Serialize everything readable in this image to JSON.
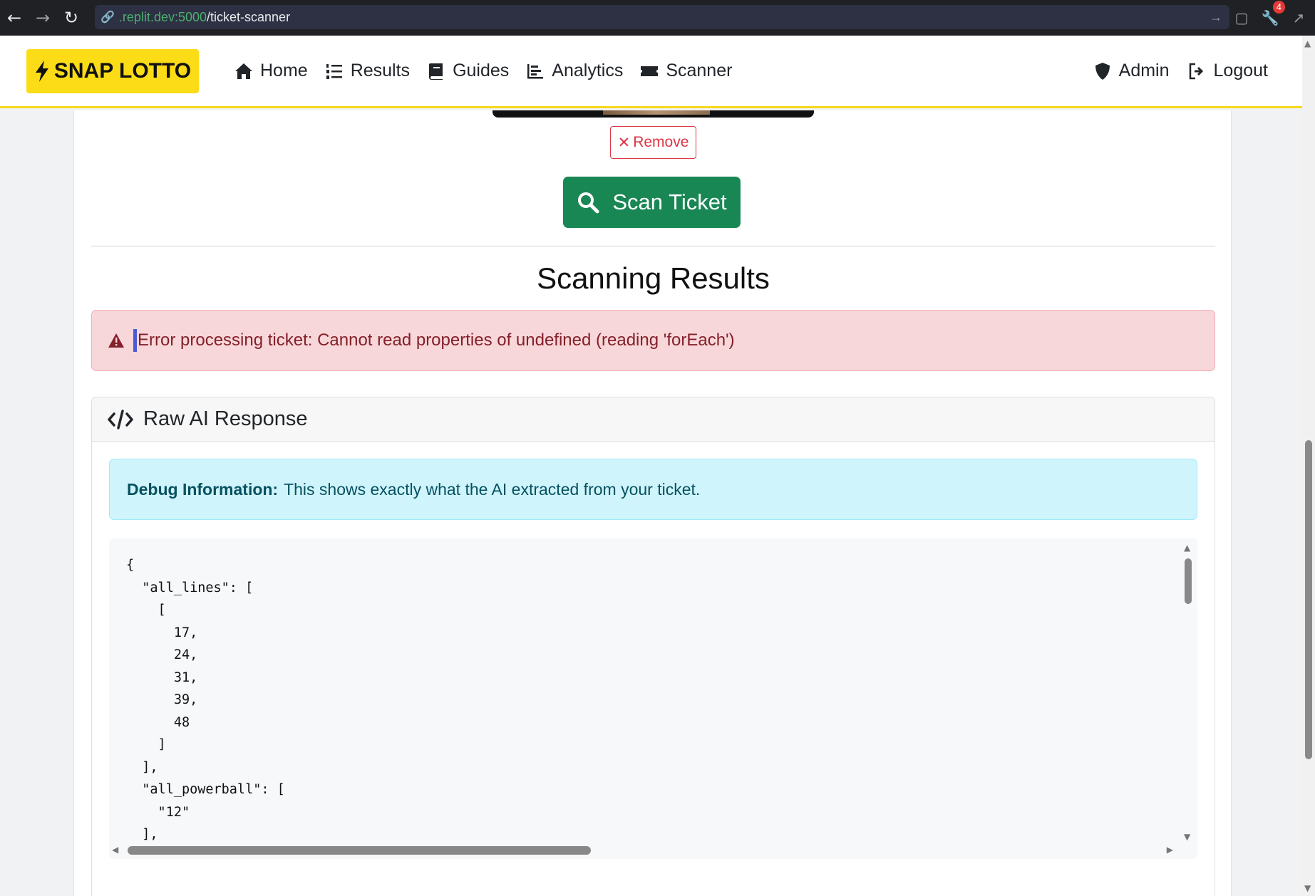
{
  "browser": {
    "url_host": ".replit.dev:5000",
    "url_path": "/ticket-scanner",
    "badge_count": "4"
  },
  "navbar": {
    "brand": "SNAP LOTTO",
    "links": [
      {
        "label": "Home",
        "icon": "home-icon"
      },
      {
        "label": "Results",
        "icon": "list-ordered-icon"
      },
      {
        "label": "Guides",
        "icon": "book-icon"
      },
      {
        "label": "Analytics",
        "icon": "chart-bar-icon"
      },
      {
        "label": "Scanner",
        "icon": "ticket-icon"
      }
    ],
    "right": [
      {
        "label": "Admin",
        "icon": "shield-icon"
      },
      {
        "label": "Logout",
        "icon": "logout-icon"
      }
    ]
  },
  "scanner": {
    "remove_label": "Remove",
    "scan_label": "Scan Ticket"
  },
  "results": {
    "title": "Scanning Results",
    "error_text": "Error processing ticket: Cannot read properties of undefined (reading 'forEach')"
  },
  "raw_panel": {
    "title": "Raw AI Response",
    "debug_label": "Debug Information:",
    "debug_text": "This shows exactly what the AI extracted from your ticket.",
    "code": "{\n  \"all_lines\": [\n    [\n      17,\n      24,\n      31,\n      39,\n      48\n    ]\n  ],\n  \"all_powerball\": [\n    \"12\"\n  ],"
  },
  "colors": {
    "brand_yellow": "#fbdc16",
    "scan_green": "#198754",
    "error_bg": "#f8d7da",
    "info_bg": "#cff4fc"
  }
}
